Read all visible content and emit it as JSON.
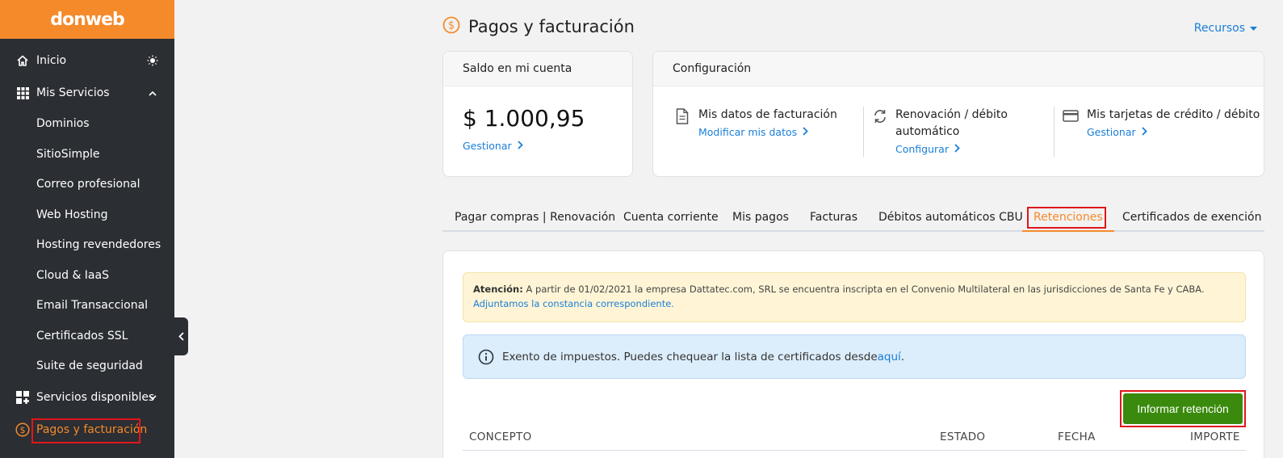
{
  "sidebar": {
    "logo": "donweb",
    "inicio": "Inicio",
    "mis_servicios": "Mis Servicios",
    "sub_items": [
      "Dominios",
      "SitioSimple",
      "Correo profesional",
      "Web Hosting",
      "Hosting revendedores",
      "Cloud & IaaS",
      "Email Transaccional",
      "Certificados SSL",
      "Suite de seguridad"
    ],
    "servicios_disponibles": "Servicios disponibles",
    "pagos": "Pagos y facturación"
  },
  "header": {
    "title": "Pagos y facturación",
    "recursos": "Recursos"
  },
  "balance_card": {
    "heading": "Saldo en mi cuenta",
    "amount": "$ 1.000,95",
    "link": "Gestionar"
  },
  "config_card": {
    "heading": "Configuración",
    "items": [
      {
        "title": "Mis datos de facturación",
        "link": "Modificar mis datos"
      },
      {
        "title_1": "Renovación / débito",
        "title_2": "automático",
        "link": "Configurar"
      },
      {
        "title": "Mis tarjetas de crédito / débito",
        "link": "Gestionar"
      }
    ]
  },
  "tabs": [
    "Pagar compras | Renovación",
    "Cuenta corriente",
    "Mis pagos",
    "Facturas",
    "Débitos automáticos CBU",
    "Retenciones",
    "Certificados de exención"
  ],
  "active_tab": "Retenciones",
  "warning": {
    "label": "Atención:",
    "text": " A partir de 01/02/2021 la empresa Dattatec.com, SRL se encuentra inscripta en el Convenio Multilateral en las jurisdicciones de Santa Fe y CABA. ",
    "link": "Adjuntamos la constancia correspondiente."
  },
  "info": {
    "text": "Exento de impuestos. Puedes chequear la lista de certificados desde ",
    "link": "aquí",
    "end": "."
  },
  "primary_button": "Informar retención",
  "table_headers": [
    "CONCEPTO",
    "ESTADO",
    "FECHA",
    "IMPORTE"
  ],
  "colors": {
    "brand": "#f58a2a",
    "link": "#1a7ed8",
    "success": "#3a8a0d",
    "highlight": "#e0161c"
  }
}
